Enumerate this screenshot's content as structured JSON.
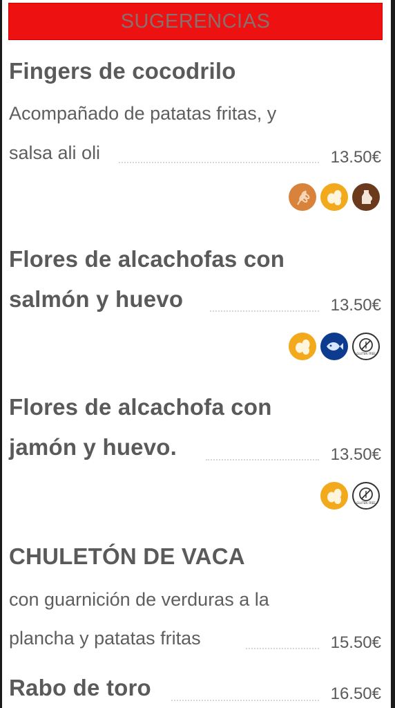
{
  "header": {
    "title": "SUGERENCIAS"
  },
  "items": [
    {
      "title": "Fingers de cocodrilo",
      "description_line1": "Acompañado de patatas fritas, y",
      "description_line2": "salsa ali oli",
      "price": "13.50€",
      "allergens": [
        "gluten-icon",
        "egg-icon",
        "dairy-icon"
      ]
    },
    {
      "title_line1": "Flores de alcachofas con",
      "title_line2": "salmón y huevo",
      "price": "13.50€",
      "allergens": [
        "egg-icon",
        "fish-icon",
        "gluten-free-icon"
      ]
    },
    {
      "title_line1": "Flores de alcachofa con",
      "title_line2": "jamón y huevo.",
      "price": "13.50€",
      "allergens": [
        "egg-icon",
        "gluten-free-icon"
      ]
    },
    {
      "title": "CHULETÓN DE VACA",
      "description_line1": "con guarnición de verduras a la",
      "description_line2": "plancha y patatas fritas",
      "price": "15.50€"
    },
    {
      "title": "Rabo de toro",
      "price": "16.50€"
    }
  ],
  "colors": {
    "header_bg": "#ee1111",
    "gluten": "#d9823b",
    "egg": "#f2a91b",
    "dairy": "#6b3a1c",
    "fish": "#0d3b8f",
    "gluten_free": "#ffffff"
  }
}
